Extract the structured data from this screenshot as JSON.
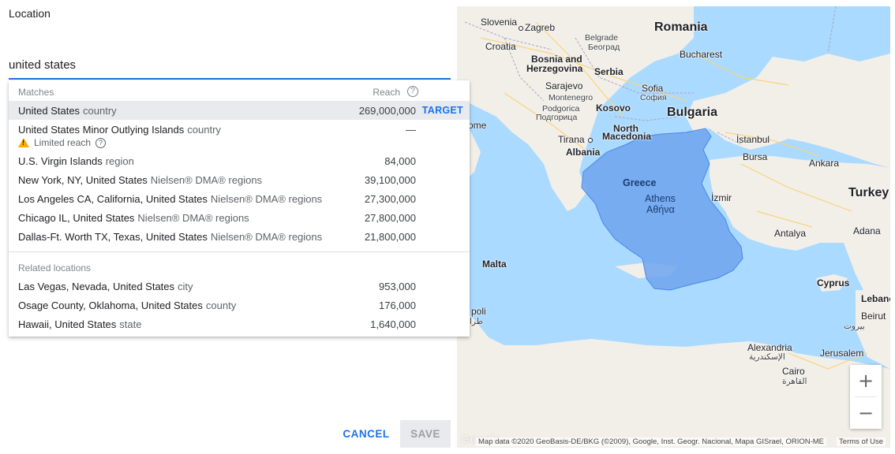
{
  "location_label": "Location",
  "search": {
    "value": "united states"
  },
  "dropdown": {
    "matches_header": "Matches",
    "reach_header": "Reach",
    "help_glyph": "?",
    "matches": [
      {
        "name": "United States",
        "type": "country",
        "reach": "269,000,000",
        "action": "TARGET"
      },
      {
        "name": "United States Minor Outlying Islands",
        "type": "country",
        "reach": "—",
        "note": "Limited reach"
      },
      {
        "name": "U.S. Virgin Islands",
        "type": "region",
        "reach": "84,000"
      },
      {
        "name": "New York, NY, United States",
        "type": "Nielsen® DMA® regions",
        "reach": "39,100,000"
      },
      {
        "name": "Los Angeles CA, California, United States",
        "type": "Nielsen® DMA® regions",
        "reach": "27,300,000"
      },
      {
        "name": "Chicago IL, United States",
        "type": "Nielsen® DMA® regions",
        "reach": "27,800,000"
      },
      {
        "name": "Dallas-Ft. Worth TX, Texas, United States",
        "type": "Nielsen® DMA® regions",
        "reach": "21,800,000"
      }
    ],
    "related_header": "Related locations",
    "related": [
      {
        "name": "Las Vegas, Nevada, United States",
        "type": "city",
        "reach": "953,000"
      },
      {
        "name": "Osage County, Oklahoma, United States",
        "type": "county",
        "reach": "176,000"
      },
      {
        "name": "Hawaii, United States",
        "type": "state",
        "reach": "1,640,000"
      }
    ]
  },
  "actions": {
    "cancel": "CANCEL",
    "save": "SAVE"
  },
  "map": {
    "labels": {
      "slovenia": "Slovenia",
      "zagreb": "Zagreb",
      "belgrade": "Belgrade",
      "belgrade_local": "Београд",
      "croatia": "Croatia",
      "romania": "Romania",
      "bosnia": "Bosnia and",
      "herzegovina": "Herzegovina",
      "serbia": "Serbia",
      "bucharest": "Bucharest",
      "sarajevo": "Sarajevo",
      "montenegro": "Montenegro",
      "sofia": "Sofia",
      "sofia_local": "София",
      "podgorica": "Podgorica",
      "podgorica_local": "Подгорица",
      "kosovo": "Kosovo",
      "bulgaria": "Bulgaria",
      "rome": "ome",
      "north": "North",
      "macedonia": "Macedonia",
      "tirana": "Tirana",
      "albania": "Albania",
      "istanbul": "İstanbul",
      "bursa": "Bursa",
      "ankara": "Ankara",
      "greece": "Greece",
      "athens": "Athens",
      "athens_local": "Αθήνα",
      "izmir": "İzmir",
      "turkey": "Turkey",
      "antalya": "Antalya",
      "adana": "Adana",
      "malta": "Malta",
      "cyprus": "Cyprus",
      "lebanon": "Lebano",
      "tripoli": "poli",
      "tripoli_local": "طرا",
      "beirut": "Beirut",
      "beirut_local": "بيروت",
      "alexandria": "Alexandria",
      "alexandria_local": "الإسكندرية",
      "jerusalem": "Jerusalem",
      "cairo": "Cairo",
      "cairo_local": "القاهرة"
    },
    "zoom_in": "+",
    "zoom_out": "−",
    "google_logo": "Google",
    "attribution": "Map data ©2020 GeoBasis-DE/BKG (©2009), Google, Inst. Geogr. Nacional, Mapa GISrael, ORION-ME",
    "terms": "Terms of Use",
    "colors": {
      "water": "#aadaff",
      "land": "#f2efe9",
      "selection": "#6fa3ee"
    }
  }
}
